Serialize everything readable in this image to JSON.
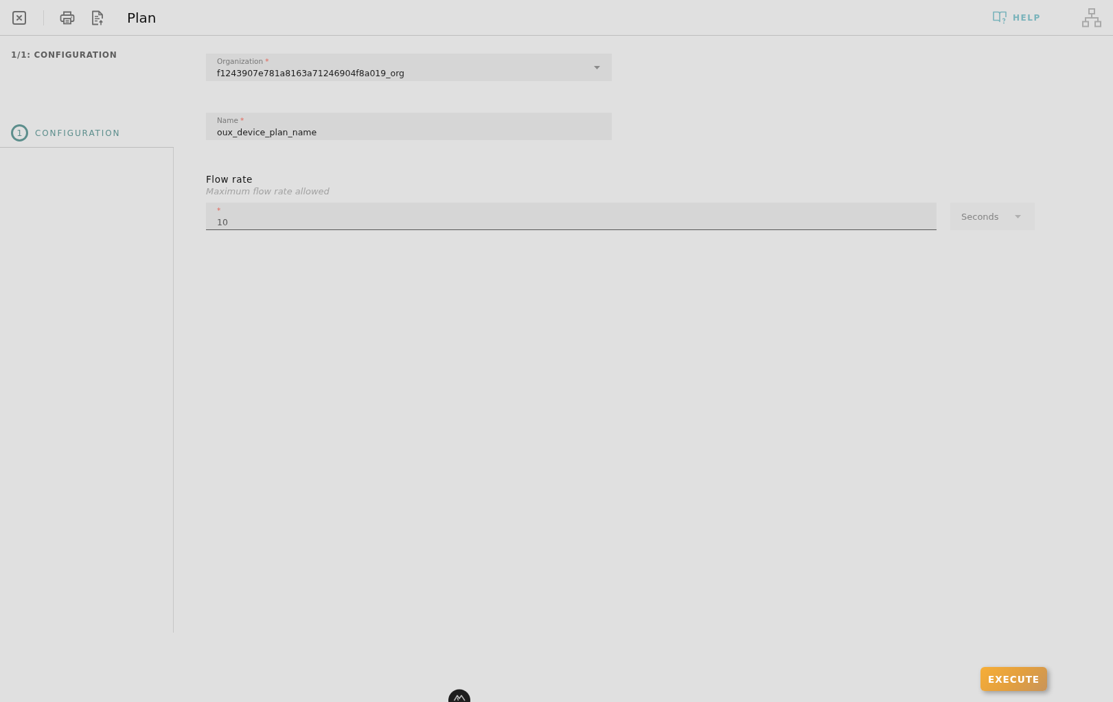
{
  "toolbar": {
    "title": "Plan",
    "help": {
      "label": "HELP",
      "disabled": true
    }
  },
  "sidebar": {
    "heading": "1/1: CONFIGURATION",
    "steps": [
      {
        "number": "1",
        "label": "CONFIGURATION",
        "selected": true
      }
    ]
  },
  "form": {
    "fields": [
      {
        "kind": "select",
        "label": "Organization",
        "required_mark": "*",
        "value": "f1243907e781a8163a71246904f8a019_org"
      },
      {
        "kind": "text",
        "label": "Name",
        "required_mark": "*",
        "value": "oux_device_plan_name"
      }
    ],
    "flow_rate": {
      "title": "Flow rate",
      "description": "Maximum flow rate allowed",
      "input": {
        "required_mark": "*",
        "value": "10"
      },
      "unit": {
        "value": "Seconds",
        "disabled": true
      }
    }
  },
  "actions": {
    "execute": {
      "label": "EXECUTE"
    }
  }
}
